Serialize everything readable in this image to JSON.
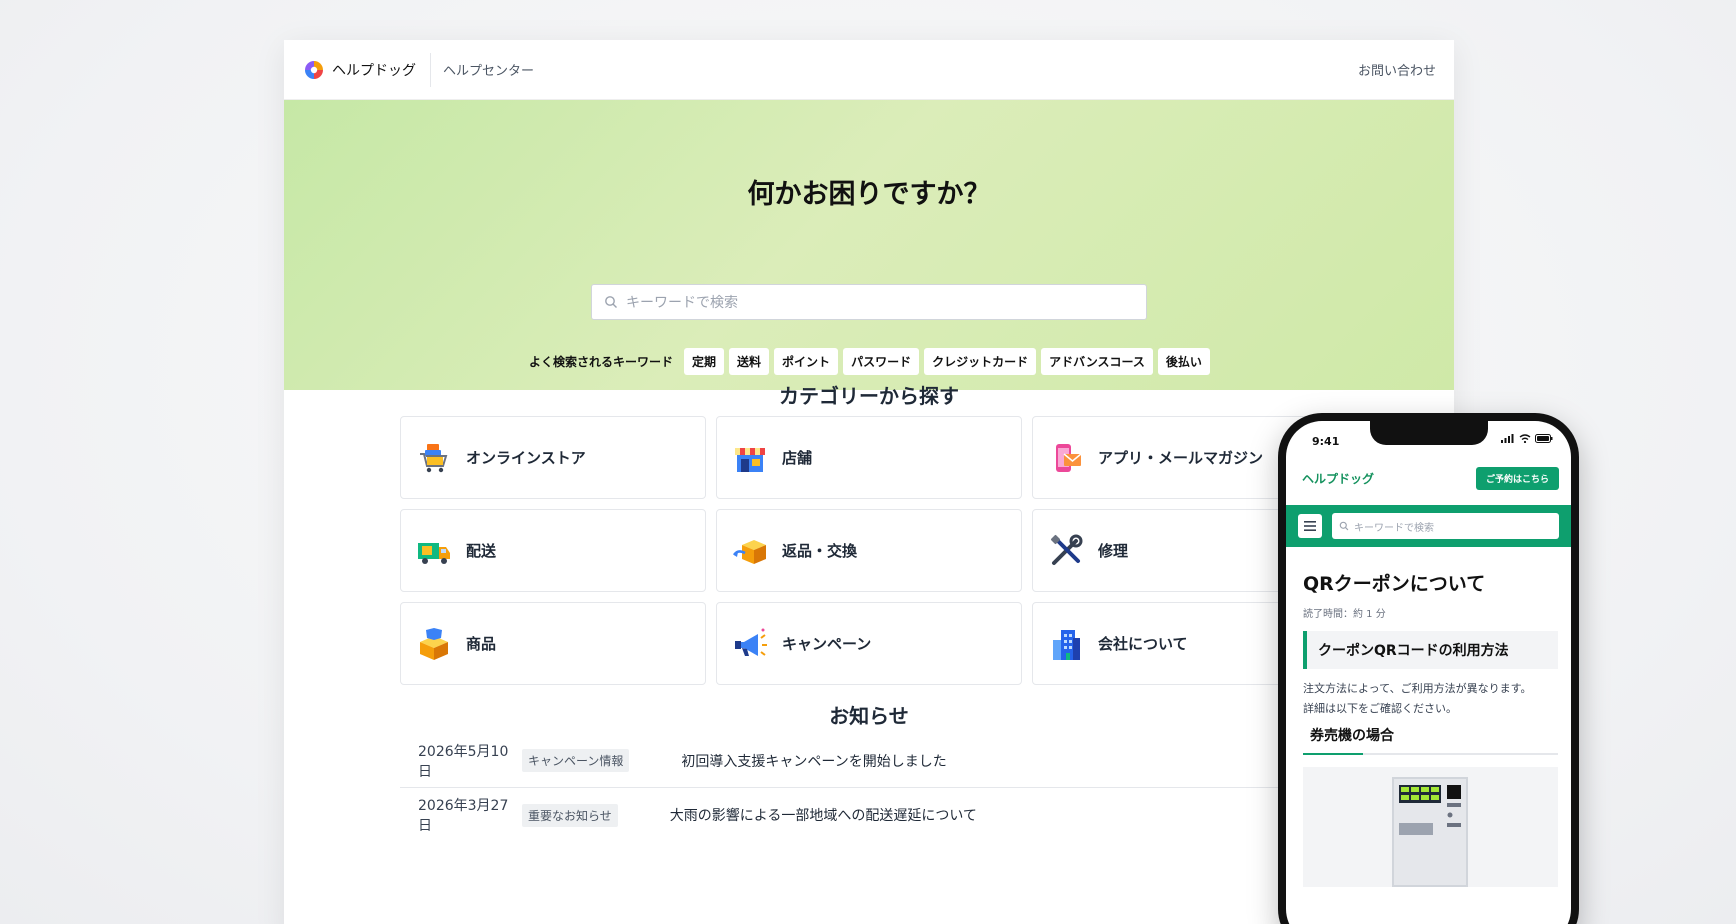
{
  "header": {
    "logo_text": "ヘルプドッグ",
    "help_center": "ヘルプセンター",
    "contact": "お問い合わせ"
  },
  "hero": {
    "title": "何かお困りですか？",
    "search_placeholder": "キーワードで検索",
    "keywords_label": "よく検索されるキーワード",
    "keywords": [
      "定期",
      "送料",
      "ポイント",
      "パスワード",
      "クレジットカード",
      "アドバンスコース",
      "後払い"
    ]
  },
  "categories": {
    "title": "カテゴリーから探す",
    "items": [
      {
        "label": "オンラインストア",
        "icon": "cart-icon"
      },
      {
        "label": "店舗",
        "icon": "store-icon"
      },
      {
        "label": "アプリ・メールマガジン",
        "icon": "app-mail-icon"
      },
      {
        "label": "配送",
        "icon": "truck-icon"
      },
      {
        "label": "返品・交換",
        "icon": "return-box-icon"
      },
      {
        "label": "修理",
        "icon": "tools-icon"
      },
      {
        "label": "商品",
        "icon": "product-box-icon"
      },
      {
        "label": "キャンペーン",
        "icon": "megaphone-icon"
      },
      {
        "label": "会社について",
        "icon": "building-icon"
      }
    ]
  },
  "news": {
    "title": "お知らせ",
    "items": [
      {
        "date": "2026年5月10日",
        "badge": "キャンペーン情報",
        "title": "初回導入支援キャンペーンを開始しました"
      },
      {
        "date": "2026年3月27日",
        "badge": "重要なお知らせ",
        "title": "大雨の影響による一部地域への配送遅延について"
      }
    ]
  },
  "phone": {
    "time": "9:41",
    "brand": "ヘルプドッグ",
    "reserve_button": "ご予約はこちら",
    "search_placeholder": "キーワードで検索",
    "article_title": "QRクーポンについて",
    "read_time": "読了時間：約 1 分",
    "section_heading": "クーポンQRコードの利用方法",
    "body_line1": "注文方法によって、ご利用方法が異なります。",
    "body_line2": "詳細は以下をご確認ください。",
    "sub_heading": "券売機の場合"
  },
  "colors": {
    "hero_green": "#cfe9a8",
    "brand_green": "#0e9f6e"
  }
}
